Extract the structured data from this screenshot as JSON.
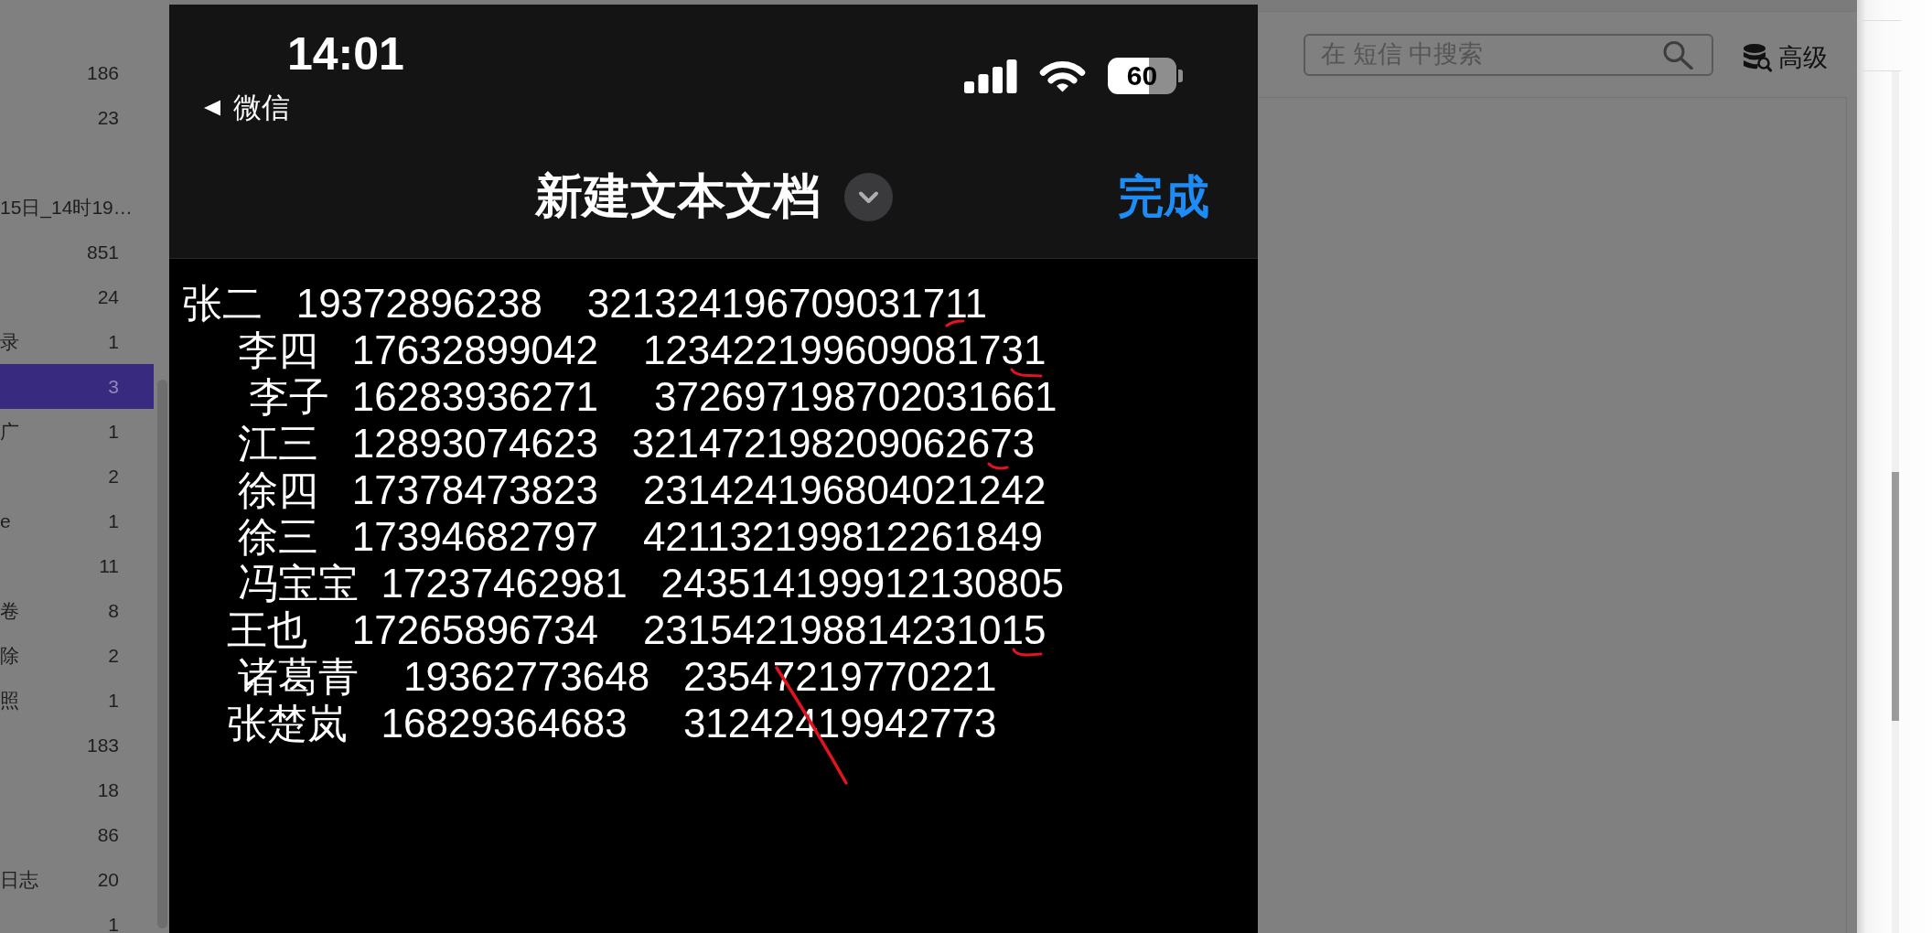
{
  "background_app": {
    "sidebar": {
      "sections": [
        {
          "items": [
            {
              "count": "186",
              "selected": false
            },
            {
              "count": "23",
              "selected": false
            }
          ]
        },
        {
          "items": [
            {
              "label": "15日_14时19…",
              "selected": false
            },
            {
              "count": "851",
              "selected": false
            },
            {
              "count": "24",
              "selected": false
            },
            {
              "label": "录",
              "count": "1",
              "selected": false
            },
            {
              "count": "3",
              "selected": true
            },
            {
              "label": "广",
              "count": "1",
              "selected": false
            },
            {
              "count": "2",
              "selected": false
            },
            {
              "label": "e",
              "count": "1",
              "selected": false
            },
            {
              "count": "11",
              "selected": false
            },
            {
              "label": "卷",
              "count": "8",
              "selected": false
            },
            {
              "label": "除",
              "count": "2",
              "selected": false
            },
            {
              "label": "照",
              "count": "1",
              "selected": false
            },
            {
              "count": "183",
              "selected": false
            },
            {
              "count": "18",
              "selected": false
            },
            {
              "count": "86",
              "selected": false
            },
            {
              "label": "日志",
              "count": "20",
              "selected": false
            },
            {
              "count": "1",
              "selected": false
            }
          ]
        }
      ]
    },
    "toolbar": {
      "search": {
        "placeholder": "在 短信 中搜索"
      },
      "advanced_button": "高级"
    }
  },
  "phone": {
    "status_bar": {
      "time": "14:01",
      "back_label": "微信",
      "battery": "60"
    },
    "nav_bar": {
      "title": "新建文本文档",
      "done_button": "完成"
    },
    "document": {
      "lines": [
        "张二   19372896238    321324196709031711",
        "     李四   17632899042    123422199609081731",
        "      李子  16283936271     372697198702031661",
        "     江三   12893074623   321472198209062673",
        "     徐四   17378473823    231424196804021242",
        "     徐三   17394682797    421132199812261849",
        "     冯宝宝  17237462981   243514199912130805",
        "    王也    17265896734    231542198814231015",
        "     诸葛青    19362773648   23547219770221",
        "    张楚岚   16829364683     31242419942773"
      ]
    }
  }
}
